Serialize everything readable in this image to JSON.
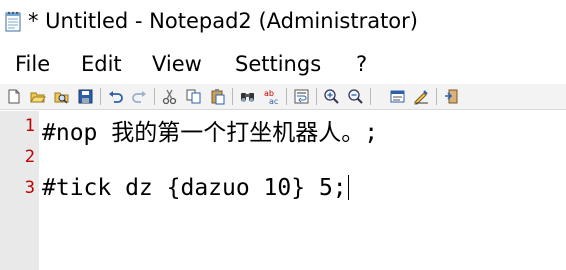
{
  "window": {
    "title": "* Untitled - Notepad2 (Administrator)",
    "icon": "notepad-icon"
  },
  "menu": {
    "items": [
      "File",
      "Edit",
      "View",
      "Settings",
      "?"
    ]
  },
  "toolbar": {
    "buttons": [
      "new-icon",
      "open-icon",
      "browse-icon",
      "save-icon",
      "undo-icon",
      "redo-icon",
      "cut-icon",
      "copy-icon",
      "paste-icon",
      "find-icon",
      "replace-icon",
      "word-wrap-icon",
      "zoom-in-icon",
      "zoom-out-icon",
      "scheme-icon",
      "customize-icon",
      "exit-icon"
    ]
  },
  "editor": {
    "lines": [
      {
        "number": "1",
        "text": "#nop 我的第一个打坐机器人。;"
      },
      {
        "number": "2",
        "text": ""
      },
      {
        "number": "3",
        "text": "#tick dz {dazuo 10} 5;"
      }
    ],
    "line_number_color": "#c00000",
    "gutter_color": "#e9e9e9"
  }
}
